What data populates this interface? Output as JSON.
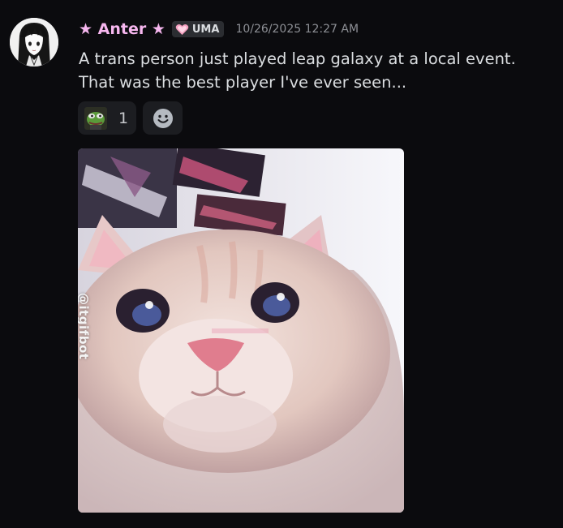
{
  "message": {
    "author": {
      "display_name": "★ Anter ★",
      "name_color": "#f7b7ef",
      "avatar_icon": "anime-girl-avatar"
    },
    "tag": {
      "icon": "pink-heart-icon",
      "label": "UMA"
    },
    "timestamp": "10/26/2025 12:27 AM",
    "content_lines": [
      "A trans person just played leap galaxy at a local event.",
      "That was the best player I've ever seen..."
    ],
    "reactions": [
      {
        "emoji": "pepe-frog-emoji",
        "count": "1"
      }
    ],
    "add_reaction_icon": "smiley-face-icon",
    "attachment": {
      "type": "gif",
      "subject": "kitten-closeup",
      "watermark": "@itgifbot"
    }
  }
}
